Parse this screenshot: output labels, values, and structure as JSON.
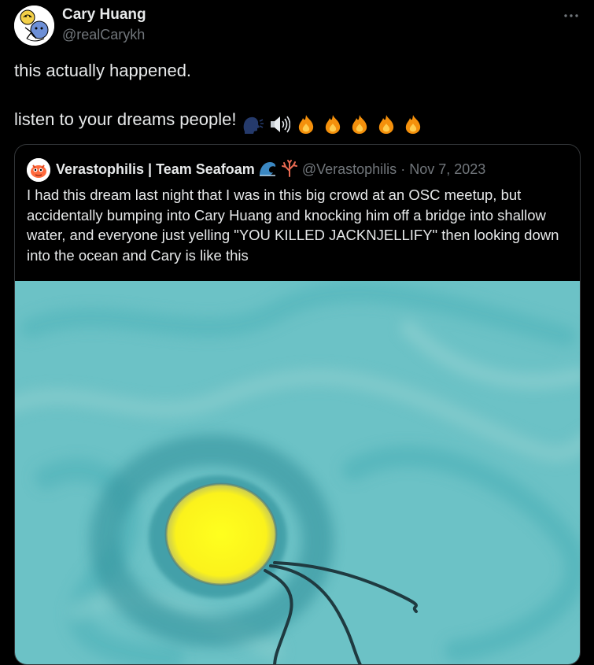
{
  "tweet": {
    "author_name": "Cary Huang",
    "author_handle": "@realCarykh",
    "text_line1": "this actually happened.",
    "text_line2": "listen to your dreams people!",
    "emojis": [
      "speaking-head",
      "speaker-loud",
      "fire",
      "fire",
      "fire",
      "fire",
      "fire"
    ],
    "more_icon": "ellipsis-icon"
  },
  "quoted": {
    "author_name": "Verastophilis | Team Seafoam",
    "badges": [
      "wave",
      "coral"
    ],
    "author_handle": "@Verastophilis",
    "separator": "·",
    "date": "Nov 7, 2023",
    "text": "I had this dream last night that I was in this big crowd at an OSC meetup, but accidentally bumping into Cary Huang and knocking him off a bridge into shallow water, and everyone just yelling \"YOU KILLED JACKNJELLIFY\" then looking down into the ocean and Cary is like this"
  },
  "colors": {
    "background": "#000000",
    "text_primary": "#e7e9ea",
    "text_secondary": "#71767b",
    "border": "#333639",
    "water": "#6cc2c6",
    "circle": "#ffff1e"
  }
}
